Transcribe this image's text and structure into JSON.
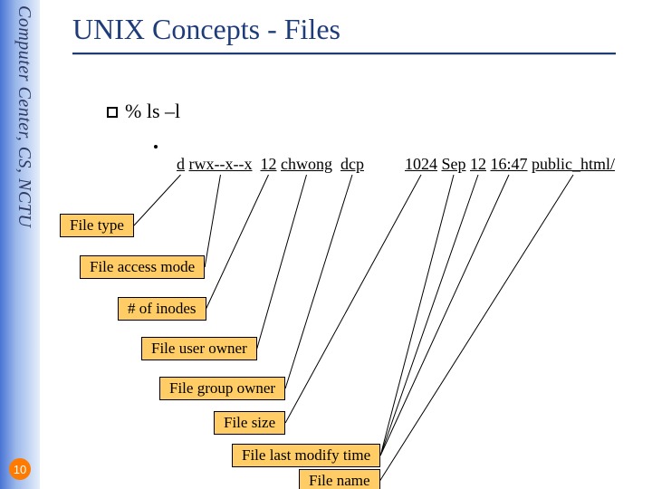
{
  "sidebar_text": "Computer Center, CS, NCTU",
  "page_number": "10",
  "title": "UNIX Concepts - Files",
  "cmd": "% ls –l",
  "ls": {
    "type": "d",
    "mode": "rwx--x--x",
    "inodes": "12",
    "user": "chwong",
    "group": "dcp",
    "size": "1024",
    "month": "Sep",
    "day": "12",
    "time": "16:47",
    "name": "public_html/"
  },
  "labels": {
    "ftype": "File type",
    "fmode": "File access mode",
    "inodes": "# of inodes",
    "fuser": "File user owner",
    "fgroup": "File group owner",
    "fsize": "File size",
    "fmtime": "File last modify time",
    "fname": "File name"
  }
}
